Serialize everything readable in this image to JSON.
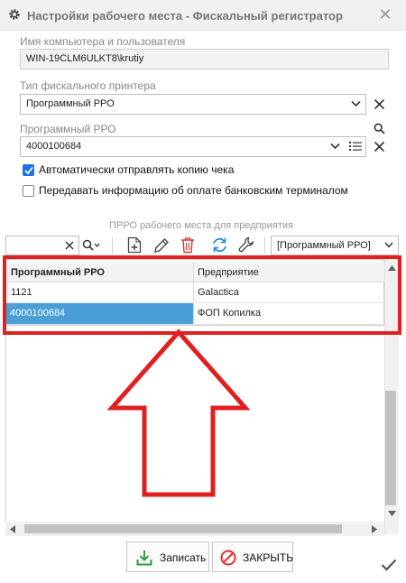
{
  "window": {
    "title": "Настройки рабочего места - Фискальный регистратор",
    "close_glyph": "✕"
  },
  "computer_user": {
    "label": "Имя компьютера и пользователя",
    "value": "WIN-19CLM6ULKT8\\krutiy"
  },
  "printer_type": {
    "label": "Тип фискального принтера",
    "value": "Программный РРО"
  },
  "prro": {
    "label": "Программный РРО",
    "value": "4000100684"
  },
  "checkboxes": [
    {
      "label": "Автоматически отправлять копию чека",
      "checked": true
    },
    {
      "label": "Передавать информацию об оплате банковским терминалом",
      "checked": false
    }
  ],
  "section": {
    "title": "ПРРО рабочего места для предприятия"
  },
  "toolbar": {
    "search_value": "",
    "filter_value": "[Программный РРО]"
  },
  "table": {
    "headers": [
      "Программный РРО",
      "Предприятие"
    ],
    "rows": [
      {
        "prro": "1121",
        "company": "Galactica",
        "selected": false
      },
      {
        "prro": "4000100684",
        "company": "ФОП Копилка",
        "selected": true
      }
    ]
  },
  "buttons": {
    "save": "Записать",
    "close": "ЗАКРЫТЬ"
  },
  "colors": {
    "accent": "#1a73e8",
    "selection": "#4a9fd6",
    "annotation": "#e02020",
    "save_icon": "#2e9e3e",
    "delete_icon": "#e03030",
    "refresh_icon": "#1e88e5"
  }
}
